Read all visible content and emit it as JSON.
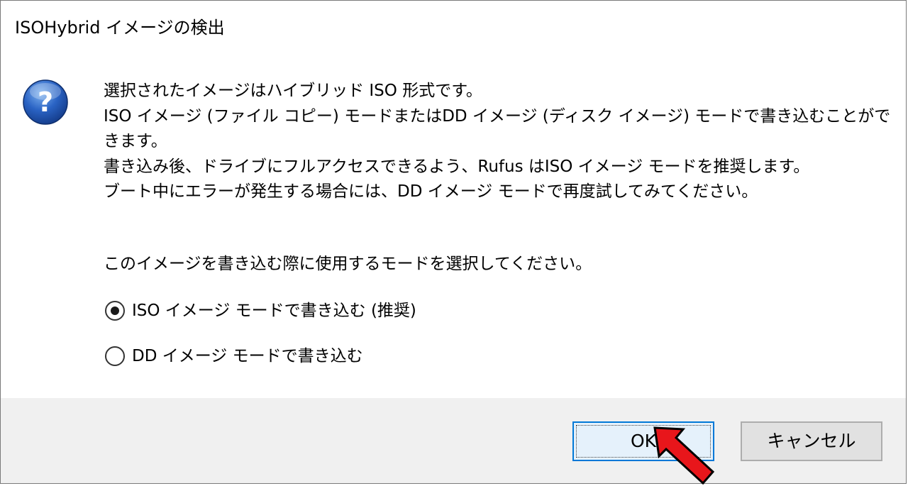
{
  "dialog": {
    "title": "ISOHybrid イメージの検出",
    "icon": "question-icon",
    "message_lines": [
      "選択されたイメージはハイブリッド ISO 形式です。",
      "ISO イメージ (ファイル コピー) モードまたはDD イメージ (ディスク イメージ) モードで書き込むことがで",
      "きます。",
      "書き込み後、ドライブにフルアクセスできるよう、Rufus はISO イメージ モードを推奨します。",
      "ブート中にエラーが発生する場合には、DD イメージ モードで再度試してみてください。"
    ],
    "prompt": "このイメージを書き込む際に使用するモードを選択してください。",
    "options": [
      {
        "label": "ISO イメージ モードで書き込む (推奨)",
        "selected": true
      },
      {
        "label": "DD イメージ モードで書き込む",
        "selected": false
      }
    ],
    "buttons": {
      "ok": "OK",
      "cancel": "キャンセル"
    }
  },
  "colors": {
    "accent": "#0078d7",
    "footer": "#f0f0f0",
    "pointer": "#e8161b"
  }
}
